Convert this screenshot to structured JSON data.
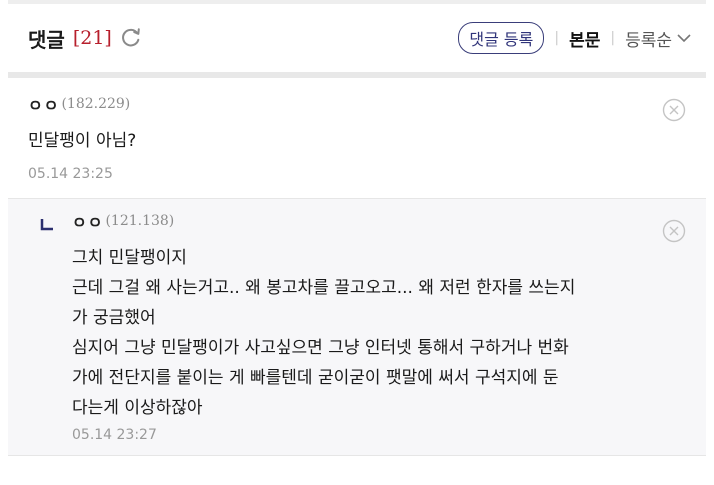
{
  "header": {
    "title": "댓글",
    "count": "[21]",
    "write_button": "댓글 등록",
    "body_link": "본문",
    "sort_label": "등록순"
  },
  "comments": [
    {
      "nick": "ㅇㅇ",
      "ip": "(182.229)",
      "text": "민달팽이 아님?",
      "date": "05.14 23:25"
    }
  ],
  "replies": [
    {
      "nick": "ㅇㅇ",
      "ip": "(121.138)",
      "lines": [
        "그치 민달팽이지",
        "근데 그걸 왜 사는거고.. 왜 봉고차를 끌고오고... 왜 저런 한자를 쓰는지",
        "가 궁금했어",
        "심지어 그냥 민달팽이가 사고싶으면 그냥 인터넷 통해서 구하거나 번화",
        "가에 전단지를 붙이는 게 빠를텐데 굳이굳이 팻말에 써서 구석지에 둔",
        "다는게 이상하잖아"
      ],
      "date": "05.14 23:27"
    }
  ],
  "icons": {
    "refresh": "refresh-icon",
    "sort": "chevron-down-icon",
    "close": "close-circle-icon",
    "reply": "reply-arrow-icon"
  },
  "colors": {
    "count": "#b71f2c",
    "button_border": "#3a3e7a",
    "reply_bg": "#f7f7f9"
  }
}
